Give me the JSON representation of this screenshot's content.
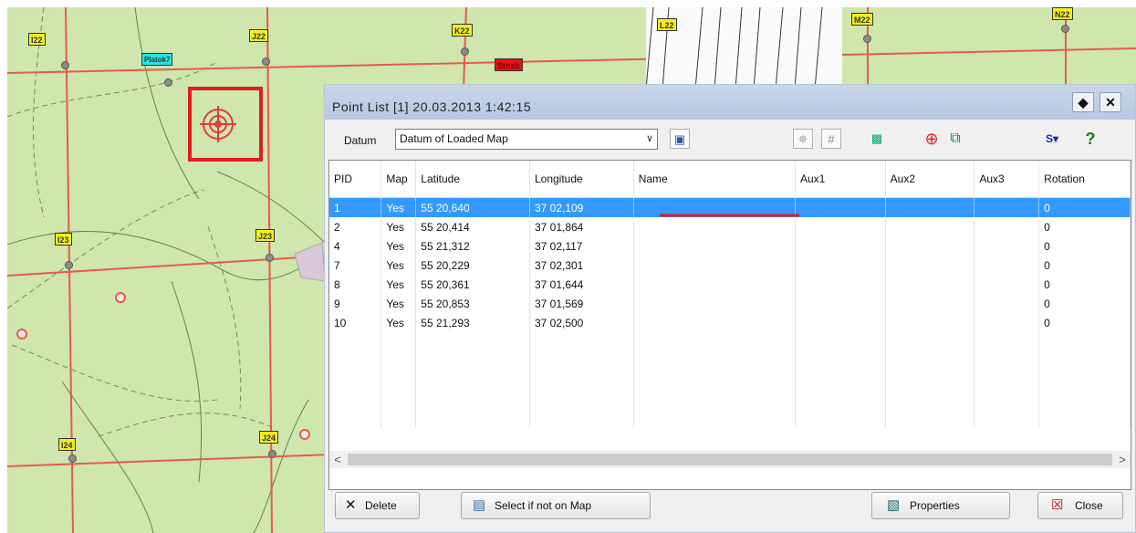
{
  "map": {
    "markers": [
      {
        "id": "I22",
        "label": "I22",
        "color": "yellow"
      },
      {
        "id": "Platok7",
        "label": "Platok7",
        "color": "cyan"
      },
      {
        "id": "J22",
        "label": "J22",
        "color": "yellow"
      },
      {
        "id": "K22",
        "label": "K22",
        "color": "yellow"
      },
      {
        "id": "Stnzb",
        "label": "Stnzb",
        "color": "red"
      },
      {
        "id": "L22",
        "label": "L22",
        "color": "yellow"
      },
      {
        "id": "M22",
        "label": "M22",
        "color": "yellow"
      },
      {
        "id": "N22",
        "label": "N22",
        "color": "yellow"
      },
      {
        "id": "I23",
        "label": "I23",
        "color": "yellow"
      },
      {
        "id": "J23",
        "label": "J23",
        "color": "yellow"
      },
      {
        "id": "I24",
        "label": "I24",
        "color": "yellow"
      },
      {
        "id": "J24",
        "label": "J24",
        "color": "yellow"
      }
    ],
    "road_color": "#e85a4a",
    "highlight_color": "#e01e1e"
  },
  "dialog": {
    "title": "Point List    [1] 20.03.2013 1:42:15",
    "title_buttons": [
      {
        "name": "pin",
        "icon": "pin-icon",
        "glyph": "◆"
      },
      {
        "name": "close",
        "icon": "close-icon",
        "glyph": "✕"
      }
    ],
    "datum": {
      "label": "Datum",
      "value": "Datum of Loaded Map",
      "arrow": "∨"
    },
    "tools": [
      {
        "name": "map-view",
        "icon": "map-icon",
        "glyph": "▣",
        "color": "#2a5aa8"
      },
      {
        "name": "sun",
        "icon": "sun-icon",
        "glyph": "✵",
        "color": "#9aa"
      },
      {
        "name": "grid",
        "icon": "grid-icon",
        "glyph": "#",
        "color": "#888"
      },
      {
        "name": "navigate",
        "icon": "navigate-icon",
        "glyph": "▩",
        "color": "#0a6"
      },
      {
        "name": "target",
        "icon": "target-icon",
        "glyph": "⊕",
        "color": "#e01e1e"
      },
      {
        "name": "copy",
        "icon": "copy-icon",
        "glyph": "⧉",
        "color": "#0a8a3a"
      },
      {
        "name": "s-menu",
        "icon": "s-menu-icon",
        "glyph": "S▾",
        "color": "#1f2fa8"
      },
      {
        "name": "help",
        "icon": "help-icon",
        "glyph": "?",
        "color": "#1a7a1a"
      }
    ],
    "columns": [
      "PID",
      "Map",
      "Latitude",
      "Longitude",
      "Name",
      "Aux1",
      "Aux2",
      "Aux3",
      "Rotation"
    ],
    "rows": [
      [
        "1",
        "Yes",
        "55 20,640",
        "37 02,109",
        "",
        "",
        "",
        "",
        "0"
      ],
      [
        "2",
        "Yes",
        "55 20,414",
        "37 01,864",
        "",
        "",
        "",
        "",
        "0"
      ],
      [
        "4",
        "Yes",
        "55 21,312",
        "37 02,117",
        "",
        "",
        "",
        "",
        "0"
      ],
      [
        "7",
        "Yes",
        "55 20,229",
        "37 02,301",
        "",
        "",
        "",
        "",
        "0"
      ],
      [
        "8",
        "Yes",
        "55 20,361",
        "37 01,644",
        "",
        "",
        "",
        "",
        "0"
      ],
      [
        "9",
        "Yes",
        "55 20,853",
        "37 01,569",
        "",
        "",
        "",
        "",
        "0"
      ],
      [
        "10",
        "Yes",
        "55 21,293",
        "37 02,500",
        "",
        "",
        "",
        "",
        "0"
      ]
    ],
    "selected_row": 0,
    "scroll_left": "<",
    "scroll_right": ">",
    "buttons": {
      "delete": {
        "label": "Delete",
        "glyph": "✕",
        "icon": "delete-icon"
      },
      "select_not_on_map": {
        "label": "Select if not on Map",
        "glyph": "▤",
        "icon": "select-icon"
      },
      "properties": {
        "label": "Properties",
        "glyph": "▧",
        "icon": "properties-icon"
      },
      "close": {
        "label": "Close",
        "glyph": "☒",
        "icon": "close-box-icon"
      }
    },
    "selection_color": "#3399ff"
  }
}
